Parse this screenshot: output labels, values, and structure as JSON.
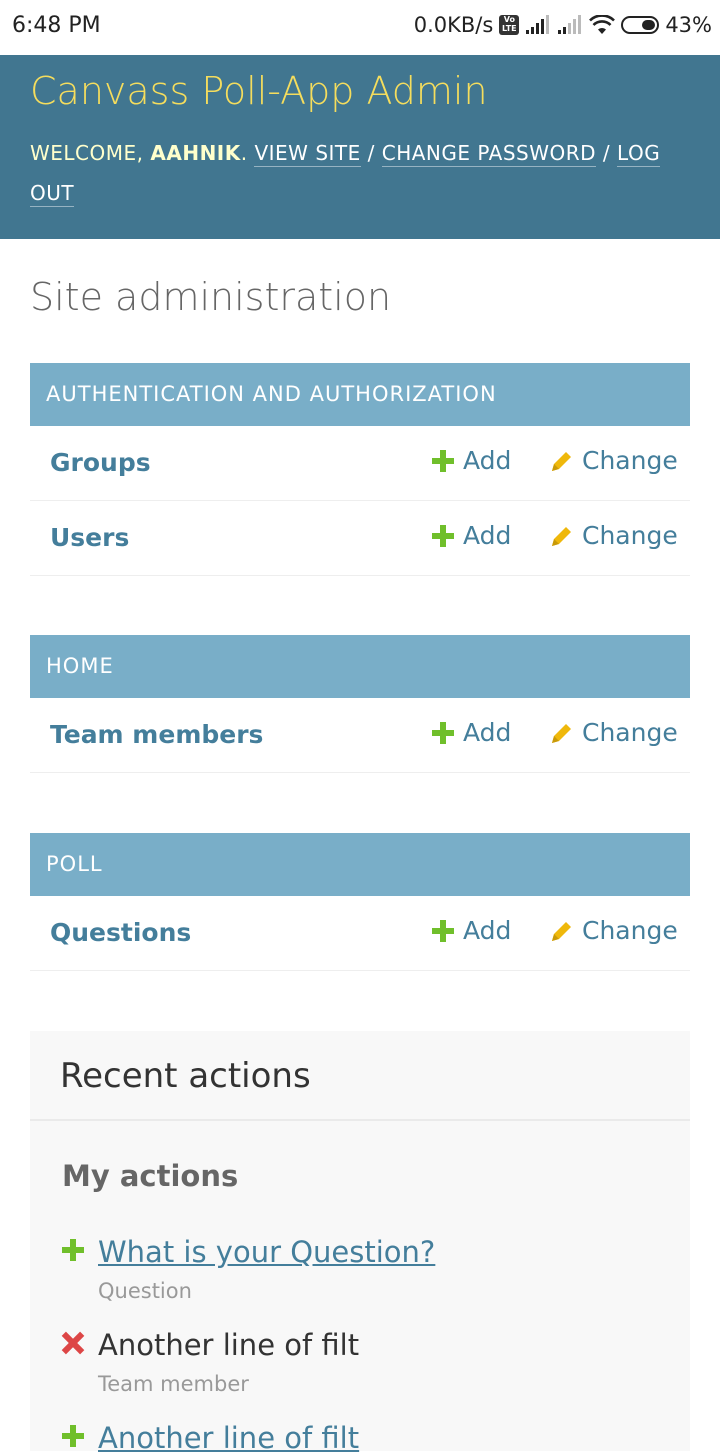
{
  "status_bar": {
    "time": "6:48 PM",
    "network_speed": "0.0KB/s",
    "volte": "Vo LTE",
    "battery": "43%",
    "battery_level": 0.43
  },
  "header": {
    "brand": "Canvass Poll-App Admin",
    "welcome": "Welcome,",
    "username": "aahnik",
    "period": ".",
    "view_site": "View site",
    "change_password": "Change password",
    "log_out": "Log out",
    "separator": "/"
  },
  "page_title": "Site administration",
  "modules": [
    {
      "caption": "Authentication and Authorization",
      "models": [
        {
          "name": "Groups",
          "add": "Add",
          "change": "Change"
        },
        {
          "name": "Users",
          "add": "Add",
          "change": "Change"
        }
      ]
    },
    {
      "caption": "Home",
      "models": [
        {
          "name": "Team members",
          "add": "Add",
          "change": "Change"
        }
      ]
    },
    {
      "caption": "Poll",
      "models": [
        {
          "name": "Questions",
          "add": "Add",
          "change": "Change"
        }
      ]
    }
  ],
  "recent_actions": {
    "title": "Recent actions",
    "subtitle": "My actions",
    "items": [
      {
        "kind": "addition",
        "icon": "add-icon",
        "text": "What is your Question?",
        "type": "Question"
      },
      {
        "kind": "deletion",
        "icon": "delete-icon",
        "text": "Another line of filt",
        "type": "Team member"
      },
      {
        "kind": "addition",
        "icon": "add-icon",
        "text": "Another line of filt",
        "type": ""
      }
    ]
  },
  "colors": {
    "header_bg": "#417690",
    "brand": "#f5dd5d",
    "caption_bg": "#79aec8",
    "link": "#447e9b",
    "add_green": "#70bf2b",
    "change_yellow": "#efb80b",
    "delete_red": "#dd4646"
  }
}
